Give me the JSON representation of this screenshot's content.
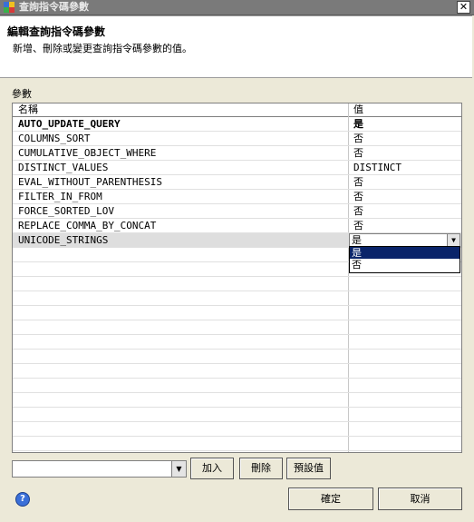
{
  "window": {
    "title": "查詢指令碼參數",
    "close_glyph": "✕"
  },
  "header": {
    "title": "編輯查詢指令碼參數",
    "description": "新增、刪除或變更查詢指令碼參數的值。"
  },
  "section_label": "參數",
  "table": {
    "columns": [
      "名稱",
      "值"
    ],
    "rows": [
      {
        "name": "AUTO_UPDATE_QUERY",
        "value": "是",
        "bold": true
      },
      {
        "name": "COLUMNS_SORT",
        "value": "否"
      },
      {
        "name": "CUMULATIVE_OBJECT_WHERE",
        "value": "否"
      },
      {
        "name": "DISTINCT_VALUES",
        "value": "DISTINCT"
      },
      {
        "name": "EVAL_WITHOUT_PARENTHESIS",
        "value": "否"
      },
      {
        "name": "FILTER_IN_FROM",
        "value": "否"
      },
      {
        "name": "FORCE_SORTED_LOV",
        "value": "否"
      },
      {
        "name": "REPLACE_COMMA_BY_CONCAT",
        "value": "否"
      },
      {
        "name": "UNICODE_STRINGS",
        "value": "是",
        "selected": true
      }
    ],
    "dropdown_options": [
      "是",
      "否"
    ],
    "dropdown_highlighted": "是"
  },
  "bottom": {
    "combo_value": "",
    "add_label": "加入",
    "delete_label": "刪除",
    "default_label": "預設值"
  },
  "footer": {
    "ok_label": "確定",
    "cancel_label": "取消"
  },
  "colors": {
    "selection": "#0a246a",
    "selected_row": "#dedede",
    "dialog_bg": "#ece9d8"
  }
}
